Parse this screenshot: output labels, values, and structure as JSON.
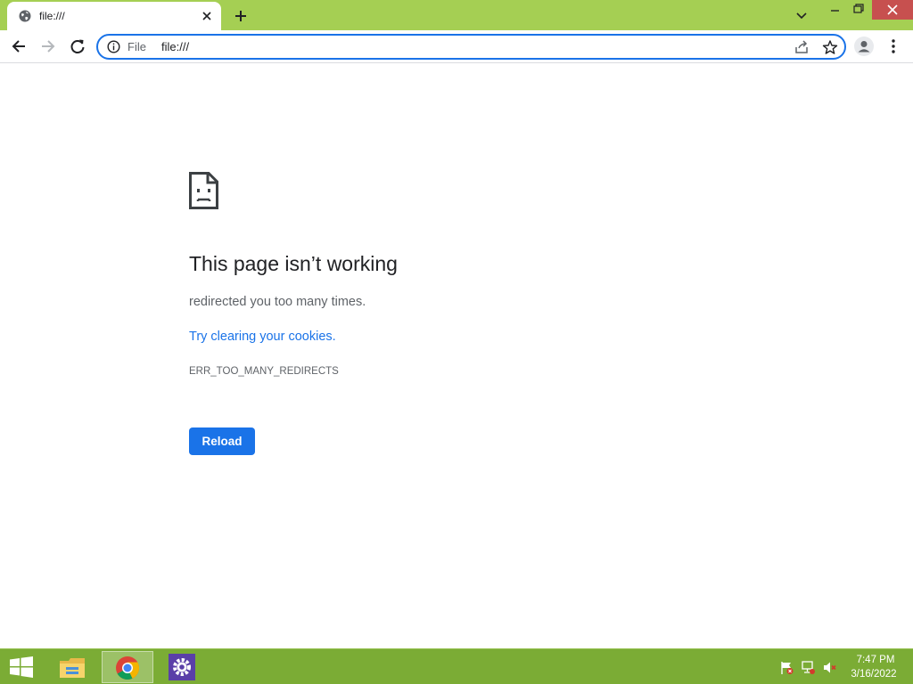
{
  "browser": {
    "tab": {
      "title": "file:///",
      "favicon": "globe-icon"
    },
    "address_bar": {
      "scheme_label": "File",
      "url": "file:///"
    },
    "colors": {
      "frame": "#a5cf53",
      "accent": "#1a73e8",
      "close_button": "#c7504f"
    }
  },
  "error_page": {
    "icon": "sad-page-icon",
    "title": "This page isn’t working",
    "description": "redirected you too many times.",
    "suggestion_link": "Try clearing your cookies.",
    "error_code": "ERR_TOO_MANY_REDIRECTS",
    "reload_label": "Reload"
  },
  "taskbar": {
    "pinned": [
      "file-explorer-icon",
      "chrome-icon",
      "settings-icon"
    ],
    "active_app": "chrome-icon",
    "tray": [
      "action-center-flag-icon",
      "network-icon",
      "volume-muted-icon"
    ],
    "time": "7:47 PM",
    "date": "3/16/2022",
    "color": "#7bac35"
  }
}
